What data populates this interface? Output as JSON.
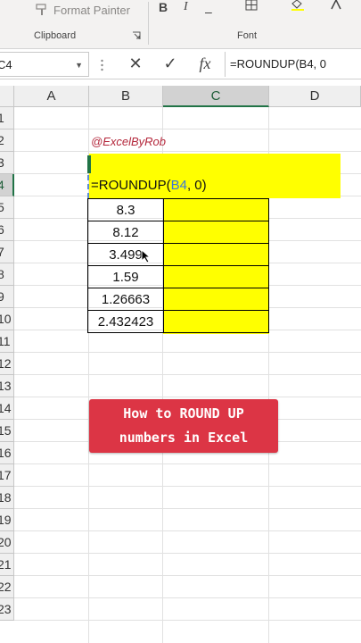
{
  "ribbon": {
    "format_painter_label": "Format Painter",
    "clipboard_label": "Clipboard",
    "font_label": "Font",
    "bold": "B",
    "italic": "I"
  },
  "formula_bar": {
    "name_box": "C4",
    "cancel_glyph": "✕",
    "enter_glyph": "✓",
    "fx_glyph": "fx",
    "formula": "=ROUNDUP(B4, 0"
  },
  "columns": [
    "A",
    "B",
    "C",
    "D"
  ],
  "rows": [
    "1",
    "2",
    "3",
    "4",
    "5",
    "6",
    "7",
    "8",
    "9",
    "10",
    "11",
    "12",
    "13",
    "14",
    "15",
    "16",
    "17",
    "18",
    "19",
    "20",
    "21",
    "22",
    "23"
  ],
  "sheet": {
    "watermark": "@ExcelByRob",
    "editing_formula_prefix": "=ROUNDUP(",
    "editing_formula_ref": "B4",
    "editing_formula_suffix": ", 0)",
    "values": [
      "8.3",
      "8.12",
      "3.499",
      "1.59",
      "1.26663",
      "2.432423"
    ]
  },
  "banner": {
    "line1": "How to ROUND UP",
    "line2": "numbers in Excel"
  },
  "colors": {
    "highlight": "#ffff00",
    "accent": "#217346",
    "banner": "#dc3545",
    "watermark": "#b4283c"
  }
}
